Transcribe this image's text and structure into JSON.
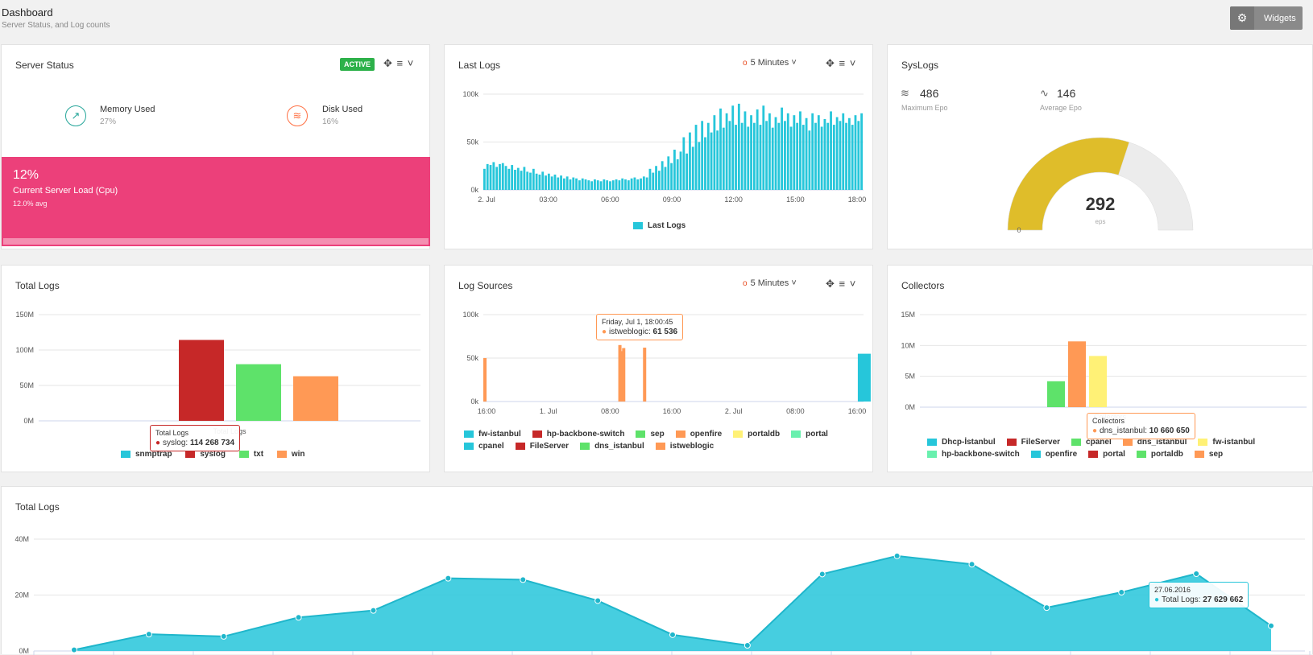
{
  "header": {
    "title": "Dashboard",
    "subtitle": "Server Status, and Log counts",
    "widgets_label": "Widgets",
    "widgets_icon": "gear-icon"
  },
  "server_status": {
    "title": "Server Status",
    "badge": "ACTIVE",
    "memory": {
      "label": "Memory Used",
      "value": "27%"
    },
    "disk": {
      "label": "Disk Used",
      "value": "16%"
    },
    "cpu": {
      "value": "12%",
      "label": "Current Server Load (Cpu)",
      "avg": "12.0% avg"
    }
  },
  "last_logs": {
    "title": "Last Logs",
    "range": "5 Minutes",
    "legend": "Last Logs"
  },
  "syslogs": {
    "title": "SysLogs",
    "max_epo": "486",
    "max_label": "Maximum Epo",
    "avg_epo": "146",
    "avg_label": "Average Epo",
    "gauge_value": "292",
    "gauge_unit": "eps",
    "gauge_min": "0",
    "gauge_max": 486
  },
  "total_logs_bar": {
    "title": "Total Logs",
    "tooltip": {
      "series_title": "Total Logs",
      "name": "syslog",
      "value": "114 268 734"
    },
    "legend": [
      "snmptrap",
      "syslog",
      "txt",
      "win"
    ]
  },
  "log_sources": {
    "title": "Log Sources",
    "range": "5 Minutes",
    "tooltip": {
      "date": "Friday, Jul 1, 18:00:45",
      "name": "istweblogic",
      "value": "61 536"
    },
    "legend_row1": [
      "fw-istanbul",
      "hp-backbone-switch",
      "sep",
      "openfire",
      "portaldb",
      "portal"
    ],
    "legend_row2": [
      "cpanel",
      "FileServer",
      "dns_istanbul",
      "istweblogic"
    ]
  },
  "collectors": {
    "title": "Collectors",
    "tooltip": {
      "series_title": "Collectors",
      "name": "dns_istanbul",
      "value": "10 660 650"
    },
    "legend_row1": [
      "Dhcp-İstanbul",
      "FileServer",
      "cpanel",
      "dns_istanbul",
      "fw-istanbul"
    ],
    "legend_row2": [
      "hp-backbone-switch",
      "openfire",
      "portal",
      "portaldb",
      "sep"
    ]
  },
  "total_logs_area": {
    "title": "Total Logs",
    "tooltip": {
      "date": "27.06.2016",
      "name": "Total Logs",
      "value": "27 629 662"
    }
  },
  "colors": {
    "cyan": "#26c6da",
    "red": "#c62828",
    "green": "#5ee26a",
    "orange": "#ff9955",
    "yellow": "#fff176",
    "mint": "#69f0ae",
    "pink": "#ec407a",
    "gold": "#dfbd2a"
  },
  "chart_data": [
    {
      "id": "last_logs",
      "type": "bar",
      "x": [
        "2. Jul",
        "03:00",
        "06:00",
        "09:00",
        "12:00",
        "15:00",
        "18:00"
      ],
      "xlabel": "",
      "ylabel": "",
      "y_ticks": [
        "0k",
        "50k",
        "100k"
      ],
      "ylim": [
        0,
        100000
      ],
      "series": [
        {
          "name": "Last Logs",
          "color": "#26c6da",
          "values": [
            22000,
            27000,
            26000,
            29000,
            24000,
            27000,
            28000,
            25000,
            22000,
            26000,
            21000,
            23000,
            20000,
            24000,
            19000,
            18000,
            22000,
            17000,
            16000,
            19000,
            15000,
            17000,
            14000,
            16000,
            13000,
            15000,
            12000,
            14000,
            11000,
            13000,
            12000,
            10000,
            12000,
            11000,
            10000,
            9000,
            11000,
            10000,
            9000,
            11000,
            10000,
            9000,
            10000,
            11000,
            10000,
            12000,
            11000,
            10000,
            12000,
            13000,
            11000,
            12000,
            14000,
            13000,
            22000,
            18000,
            25000,
            20000,
            30000,
            24000,
            35000,
            28000,
            42000,
            32000,
            40000,
            55000,
            38000,
            60000,
            45000,
            68000,
            50000,
            72000,
            55000,
            70000,
            60000,
            78000,
            62000,
            85000,
            65000,
            80000,
            72000,
            88000,
            68000,
            90000,
            70000,
            82000,
            66000,
            78000,
            70000,
            84000,
            68000,
            88000,
            72000,
            80000,
            65000,
            76000,
            70000,
            86000,
            72000,
            80000,
            66000,
            78000,
            70000,
            82000,
            68000,
            75000,
            62000,
            80000,
            70000,
            78000,
            66000,
            74000,
            70000,
            82000,
            68000,
            76000,
            72000,
            80000,
            70000,
            75000,
            68000,
            78000,
            72000,
            80000
          ]
        }
      ]
    },
    {
      "id": "syslogs_gauge",
      "type": "gauge",
      "value": 292,
      "min": 0,
      "max": 486,
      "unit": "eps"
    },
    {
      "id": "total_logs_bar",
      "type": "bar",
      "categories": [
        "snmptrap",
        "syslog",
        "txt",
        "win"
      ],
      "values": [
        0,
        114268734,
        80000000,
        63000000
      ],
      "colors": [
        "#26c6da",
        "#c62828",
        "#5ee26a",
        "#ff9955"
      ],
      "xlabel": "Total Logs",
      "y_ticks": [
        "0M",
        "50M",
        "100M",
        "150M"
      ],
      "ylim": [
        0,
        150000000
      ]
    },
    {
      "id": "log_sources",
      "type": "bar",
      "x": [
        "16:00",
        "1. Jul",
        "08:00",
        "16:00",
        "2. Jul",
        "08:00",
        "16:00"
      ],
      "y_ticks": [
        "0k",
        "50k",
        "100k"
      ],
      "ylim": [
        0,
        100000
      ],
      "spikes": [
        {
          "series": "openfire",
          "pos": 0.0,
          "value": 50000,
          "color": "#ff9955"
        },
        {
          "series": "istweblogic",
          "pos": 0.355,
          "value": 65000,
          "color": "#ff9955"
        },
        {
          "series": "istweblogic",
          "pos": 0.36,
          "value": 58000,
          "color": "#ff9955"
        },
        {
          "series": "istweblogic",
          "pos": 0.365,
          "value": 61536,
          "color": "#ff9955"
        },
        {
          "series": "istweblogic",
          "pos": 0.42,
          "value": 62000,
          "color": "#ff9955"
        },
        {
          "series": "fw-istanbul",
          "pos": 0.985,
          "value": 55000,
          "color": "#26c6da"
        }
      ]
    },
    {
      "id": "collectors",
      "type": "bar",
      "categories": [
        "Dhcp-İstanbul",
        "FileServer",
        "cpanel",
        "dns_istanbul",
        "fw-istanbul",
        "hp-backbone-switch",
        "openfire",
        "portal",
        "portaldb",
        "sep"
      ],
      "values": [
        0,
        0,
        4200000,
        10660650,
        8300000,
        0,
        0,
        0,
        0,
        0
      ],
      "colors": [
        "#26c6da",
        "#c62828",
        "#5ee26a",
        "#ff9955",
        "#fff176",
        "#69f0ae",
        "#26c6da",
        "#c62828",
        "#5ee26a",
        "#ff9955"
      ],
      "xlabel": "Collectors",
      "y_ticks": [
        "0M",
        "5M",
        "10M",
        "15M"
      ],
      "ylim": [
        0,
        15000000
      ]
    },
    {
      "id": "total_logs_area",
      "type": "area",
      "series": [
        {
          "name": "Total Logs",
          "color": "#26c6da",
          "values": [
            400000,
            6000000,
            5200000,
            12000000,
            14500000,
            26000000,
            25500000,
            18000000,
            5800000,
            2000000,
            27500000,
            34000000,
            31000000,
            15500000,
            21000000,
            27629662,
            9000000
          ]
        }
      ],
      "y_ticks": [
        "0M",
        "20M",
        "40M"
      ],
      "ylim": [
        0,
        40000000
      ]
    }
  ]
}
